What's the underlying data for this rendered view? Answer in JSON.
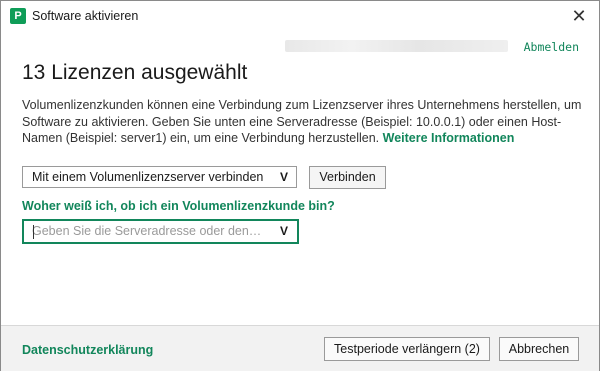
{
  "window": {
    "title": "Software aktivieren",
    "app_icon_glyph": "P",
    "close_glyph": "✕"
  },
  "account": {
    "logout_label": "Abmelden"
  },
  "main": {
    "heading": "13 Lizenzen ausgewählt",
    "description": "Volumenlizenzkunden können eine Verbindung zum Lizenzserver ihres Unternehmens herstellen, um Software zu aktivieren. Geben Sie unten eine Serveradresse (Beispiel: 10.0.0.1) oder einen Host-Namen (Beispiel: server1) ein, um eine Verbindung herzustellen.",
    "more_info_link": "Weitere Informationen",
    "connection_mode": {
      "selected": "Mit einem Volumenlizenzserver verbinden",
      "chevron": "V"
    },
    "connect_button": "Verbinden",
    "volume_question_link": "Woher weiß ich, ob ich ein Volumenlizenzkunde bin?",
    "server_input": {
      "placeholder": "Geben Sie die Serveradresse oder den…",
      "chevron": "V"
    }
  },
  "footer": {
    "privacy_link": "Datenschutzerklärung",
    "extend_trial_button": "Testperiode verlängern (2)",
    "cancel_button": "Abbrechen"
  },
  "colors": {
    "accent": "#12865b",
    "brand": "#0f9d58",
    "footer_bg": "#f2f2f2"
  }
}
